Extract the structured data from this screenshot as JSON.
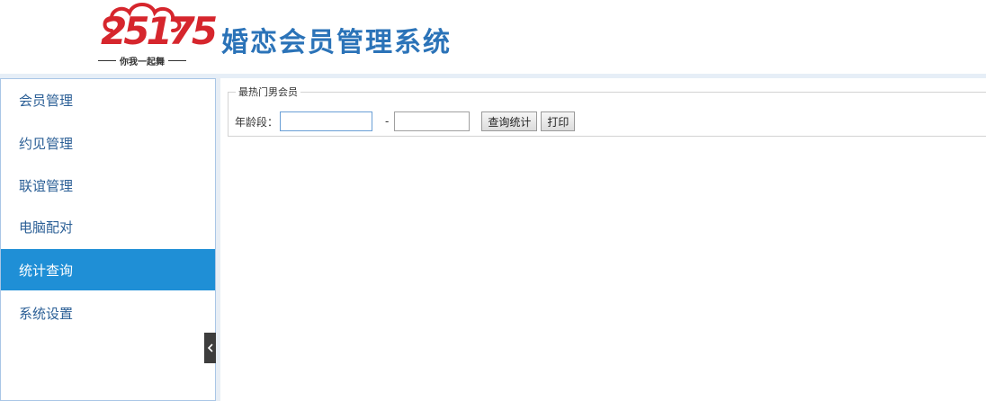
{
  "header": {
    "logo_number": "25175",
    "logo_slogan": "你我一起舞",
    "title": "婚恋会员管理系统"
  },
  "sidebar": {
    "items": [
      {
        "label": "会员管理",
        "active": false
      },
      {
        "label": "约见管理",
        "active": false
      },
      {
        "label": "联谊管理",
        "active": false
      },
      {
        "label": "电脑配对",
        "active": false
      },
      {
        "label": "统计查询",
        "active": true
      },
      {
        "label": "系统设置",
        "active": false
      }
    ],
    "collapse_icon": "chevron-left-icon"
  },
  "main": {
    "section_legend": "最热门男会员",
    "age_label": "年龄段：",
    "age_from_value": "",
    "age_separator": "-",
    "age_to_value": "",
    "query_button": "查询统计",
    "print_button": "打印"
  },
  "colors": {
    "title_blue": "#2b73b8",
    "active_nav": "#1f8fd6",
    "nav_text": "#2b5f96",
    "logo_red": "#d6262d"
  }
}
